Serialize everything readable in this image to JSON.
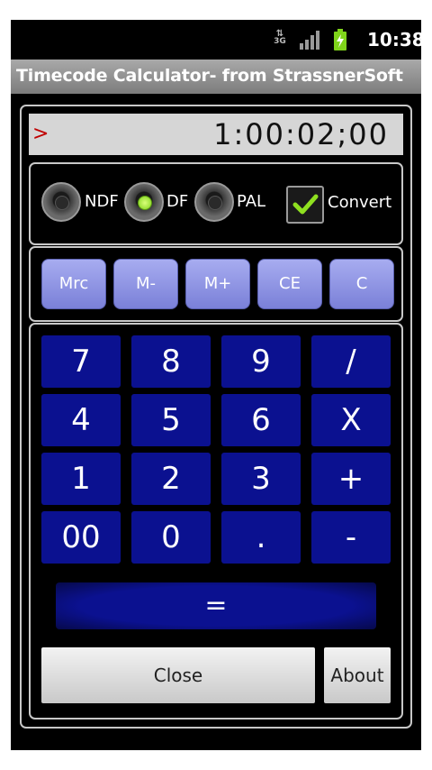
{
  "status": {
    "network_label": "3G",
    "time": "10:38"
  },
  "app": {
    "title": "Timecode Calculator- from StrassnerSoft"
  },
  "display": {
    "prompt": ">",
    "value": "1:00:02;00"
  },
  "mode": {
    "options": [
      {
        "label": "NDF",
        "selected": false
      },
      {
        "label": "DF",
        "selected": true
      },
      {
        "label": "PAL",
        "selected": false
      }
    ],
    "convert": {
      "label": "Convert",
      "checked": true
    }
  },
  "memory": {
    "buttons": [
      "Mrc",
      "M-",
      "M+",
      "CE",
      "C"
    ]
  },
  "keypad": {
    "rows": [
      [
        "7",
        "8",
        "9",
        "/"
      ],
      [
        "4",
        "5",
        "6",
        "X"
      ],
      [
        "1",
        "2",
        "3",
        "+"
      ],
      [
        "00",
        "0",
        ".",
        "-"
      ]
    ],
    "equals": "="
  },
  "actions": {
    "close": "Close",
    "about": "About"
  },
  "colors": {
    "key_blue": "#0b1190",
    "memory_lilac": "#9ea3ec",
    "radio_on": "#8fe020",
    "prompt_red": "#c00000"
  }
}
